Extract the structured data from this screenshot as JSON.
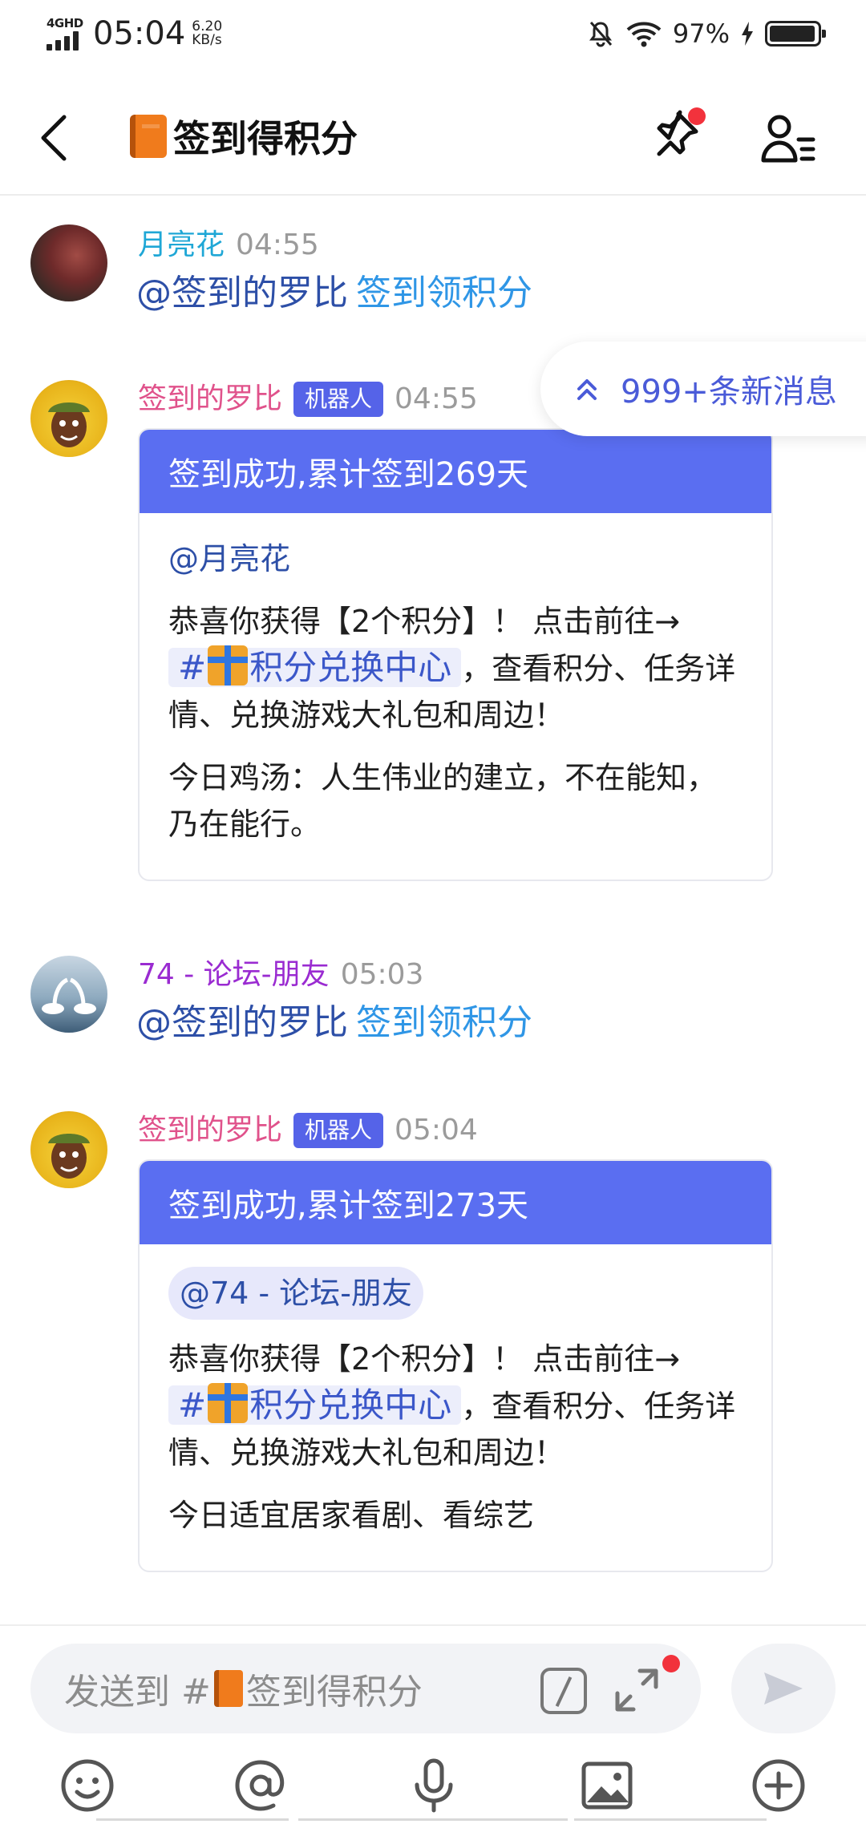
{
  "status_bar": {
    "network": "4GHD",
    "time": "05:04",
    "speed_value": "6.20",
    "speed_unit": "KB/s",
    "battery_pct": "97%",
    "battery_level": 0.97
  },
  "header": {
    "back_icon": "back-arrow-icon",
    "title": "签到得积分",
    "pin_icon": "pin-icon",
    "members_icon": "member-list-icon"
  },
  "new_messages": {
    "label": "999+条新消息"
  },
  "messages": [
    {
      "author": "月亮花",
      "time": "04:55",
      "mention": "@签到的罗比",
      "command": "签到领积分"
    },
    {
      "author": "签到的罗比",
      "badge": "机器人",
      "time": "04:55",
      "card": {
        "title": "签到成功,累计签到269天",
        "at": "@月亮花",
        "line1": "恭喜你获得【2个积分】！ 点击前往→",
        "channel_prefix": "#",
        "channel_name": "积分兑换中心",
        "line2": "，查看积分、任务详情、兑换游戏大礼包和周边！",
        "quote": "今日鸡汤：人生伟业的建立，不在能知，乃在能行。"
      }
    },
    {
      "author": "74 - 论坛-朋友",
      "time": "05:03",
      "mention": "@签到的罗比",
      "command": "签到领积分"
    },
    {
      "author": "签到的罗比",
      "badge": "机器人",
      "time": "05:04",
      "card": {
        "title": "签到成功,累计签到273天",
        "at": "@74 - 论坛-朋友",
        "line1": "恭喜你获得【2个积分】！ 点击前往→",
        "channel_prefix": "#",
        "channel_name": "积分兑换中心",
        "line2": "，查看积分、任务详情、兑换游戏大礼包和周边！",
        "quote": "今日适宜居家看剧、看综艺"
      }
    }
  ],
  "input": {
    "placeholder_prefix": "发送到 #",
    "placeholder_channel": "签到得积分"
  },
  "toolbar": {
    "icons": [
      "emoji-icon",
      "at-icon",
      "microphone-icon",
      "image-icon",
      "plus-icon"
    ]
  },
  "colors": {
    "accent": "#5a6ef1",
    "bot_name": "#e0528b",
    "link": "#2f96e6",
    "mention": "#2d4fa7",
    "badge_dot": "#f2323c"
  }
}
